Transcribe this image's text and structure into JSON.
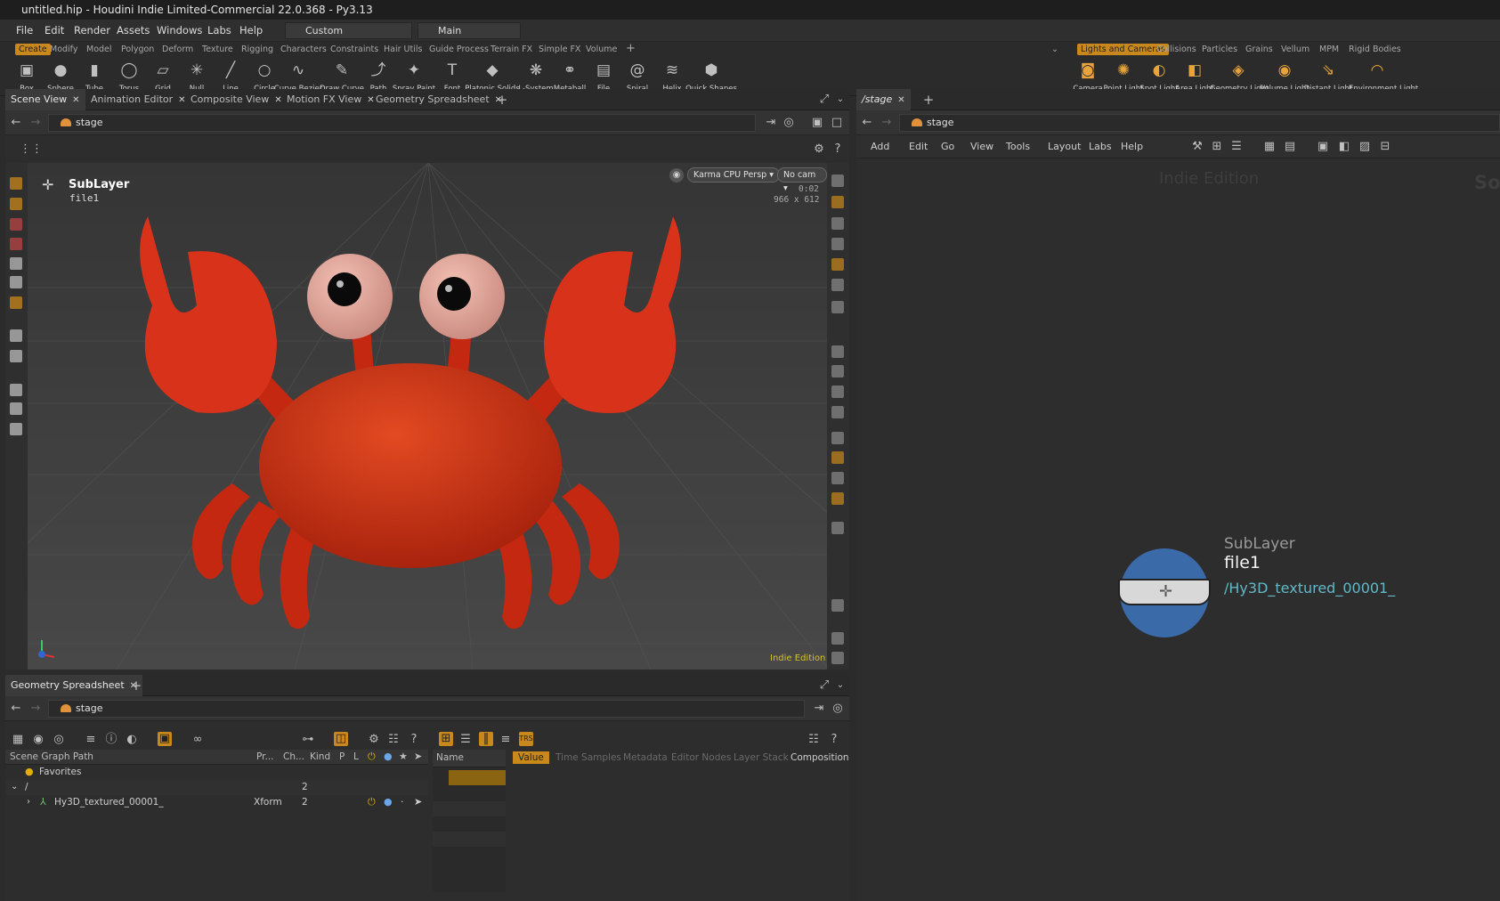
{
  "window": {
    "title": "untitled.hip - Houdini Indie Limited-Commercial 22.0.368 - Py3.13"
  },
  "menubar": {
    "items": [
      "File",
      "Edit",
      "Render",
      "Assets",
      "Windows",
      "Labs",
      "Help"
    ],
    "desktop": "Custom",
    "context": "Main"
  },
  "shelf_tabs_left": [
    "Create",
    "Modify",
    "Model",
    "Polygon",
    "Deform",
    "Texture",
    "Rigging",
    "Characters",
    "Constraints",
    "Hair Utils",
    "Guide Process",
    "Terrain FX",
    "Simple FX",
    "Volume"
  ],
  "shelf_tabs_right": [
    "Lights and Cameras",
    "Collisions",
    "Particles",
    "Grains",
    "Vellum",
    "MPM",
    "Rigid Bodies"
  ],
  "tools_left": [
    {
      "label": "Box",
      "icon": "box-icon"
    },
    {
      "label": "Sphere",
      "icon": "sphere-icon"
    },
    {
      "label": "Tube",
      "icon": "tube-icon"
    },
    {
      "label": "Torus",
      "icon": "torus-icon"
    },
    {
      "label": "Grid",
      "icon": "grid-icon"
    },
    {
      "label": "Null",
      "icon": "null-icon"
    },
    {
      "label": "Line",
      "icon": "line-icon"
    },
    {
      "label": "Circle",
      "icon": "circle-icon"
    },
    {
      "label": "Curve Bezier",
      "icon": "curve-bezier-icon"
    },
    {
      "label": "Draw Curve",
      "icon": "draw-curve-icon"
    },
    {
      "label": "Path",
      "icon": "path-icon"
    },
    {
      "label": "Spray Paint",
      "icon": "spray-paint-icon"
    },
    {
      "label": "Font",
      "icon": "font-icon"
    },
    {
      "label": "Platonic Solids",
      "icon": "platonic-solids-icon"
    },
    {
      "label": "L-System",
      "icon": "l-system-icon"
    },
    {
      "label": "Metaball",
      "icon": "metaball-icon"
    },
    {
      "label": "File",
      "icon": "file-icon"
    },
    {
      "label": "Spiral",
      "icon": "spiral-icon"
    },
    {
      "label": "Helix",
      "icon": "helix-icon"
    },
    {
      "label": "Quick Shapes",
      "icon": "quick-shapes-icon"
    }
  ],
  "tools_right": [
    {
      "label": "Camera",
      "icon": "camera-icon"
    },
    {
      "label": "Point Light",
      "icon": "point-light-icon"
    },
    {
      "label": "Spot Light",
      "icon": "spot-light-icon"
    },
    {
      "label": "Area Light",
      "icon": "area-light-icon"
    },
    {
      "label": "Geometry Light",
      "icon": "geometry-light-icon"
    },
    {
      "label": "Volume Light",
      "icon": "volume-light-icon"
    },
    {
      "label": "Distant Light",
      "icon": "distant-light-icon"
    },
    {
      "label": "Environment Light",
      "icon": "environment-light-icon"
    }
  ],
  "left_tabs": [
    "Scene View",
    "Animation Editor",
    "Composite View",
    "Motion FX View",
    "Geometry Spreadsheet"
  ],
  "path": "stage",
  "viewport": {
    "node_type": "SubLayer",
    "node_name": "file1",
    "renderer": "Karma CPU Persp",
    "camera": "No cam",
    "time": "0:02",
    "resolution": "966 x 612",
    "edition": "Indie Edition"
  },
  "right_tab": "/stage",
  "network": {
    "menus": [
      "Add",
      "Edit",
      "Go",
      "View",
      "Tools",
      "Layout",
      "Labs",
      "Help"
    ],
    "watermark": "Indie Edition",
    "edge_text": "So",
    "node_type": "SubLayer",
    "node_name": "file1",
    "node_path": "/Hy3D_textured_00001_"
  },
  "bottom": {
    "tab": "Geometry Spreadsheet",
    "columns": [
      "Scene Graph Path",
      "Pr...",
      "Ch...",
      "Kind",
      "P",
      "L"
    ],
    "favorites": "Favorites",
    "rows": [
      {
        "name": "/",
        "children": "2",
        "kind": ""
      },
      {
        "name": "Hy3D_textured_00001_",
        "children": "2",
        "kind": "Xform"
      }
    ],
    "name_header": "Name",
    "tabs": [
      "Value",
      "Time Samples",
      "Metadata",
      "Editor Nodes",
      "Layer Stack",
      "Composition"
    ]
  },
  "colors": {
    "accent": "#c9881b",
    "crab": "#d8331a",
    "node_ring": "#3b6aa8",
    "node_path": "#63b8c8"
  }
}
